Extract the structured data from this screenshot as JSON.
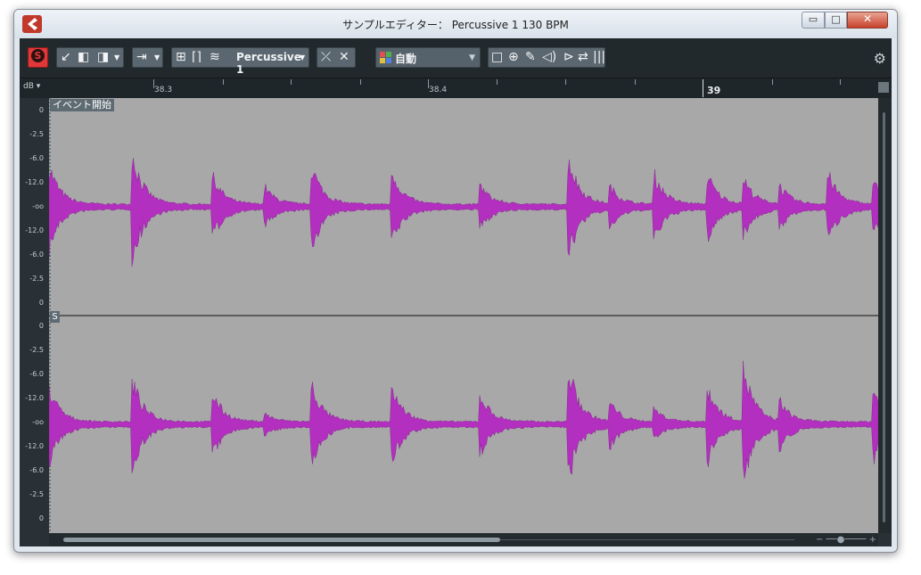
{
  "window": {
    "title": "サンプルエディター： Percussive 1 130 BPM",
    "minimize_glyph": "▭",
    "maximize_glyph": "□",
    "close_glyph": "✕"
  },
  "toolbar": {
    "solo_label": "S",
    "clip_name": "Percussive 1",
    "mode_label": "自動",
    "icons": [
      "solo-icon",
      "arrow-in-icon",
      "panel-left-icon",
      "panel-right-icon",
      "insert-icon",
      "snap-icon",
      "marker-icon",
      "layers-icon",
      "warp-icon",
      "crossfade-icon",
      "grid-color-icon",
      "select-icon",
      "zoom-icon",
      "pencil-icon",
      "speaker-icon",
      "play-icon",
      "loop-icon",
      "bars-icon",
      "gear-icon"
    ]
  },
  "ruler": {
    "db_label": "dB",
    "positions": [
      "38.3",
      "38.4",
      "39"
    ]
  },
  "scale": {
    "top": [
      "0",
      "-2.5",
      "-6.0",
      "-12.0",
      "-oo",
      "-12.0",
      "-6.0",
      "-2.5",
      "0"
    ],
    "bottom": [
      "0",
      "-2.5",
      "-6.0",
      "-12.0",
      "-oo",
      "-12.0",
      "-6.0",
      "-2.5",
      "0"
    ]
  },
  "markers": {
    "event_start": "イベント開始",
    "s": "S"
  },
  "waveform": {
    "color": "#b32fbf",
    "background": "#a8a8a8"
  },
  "hscroll": {
    "zoom_minus": "−",
    "zoom_plus": "+"
  }
}
